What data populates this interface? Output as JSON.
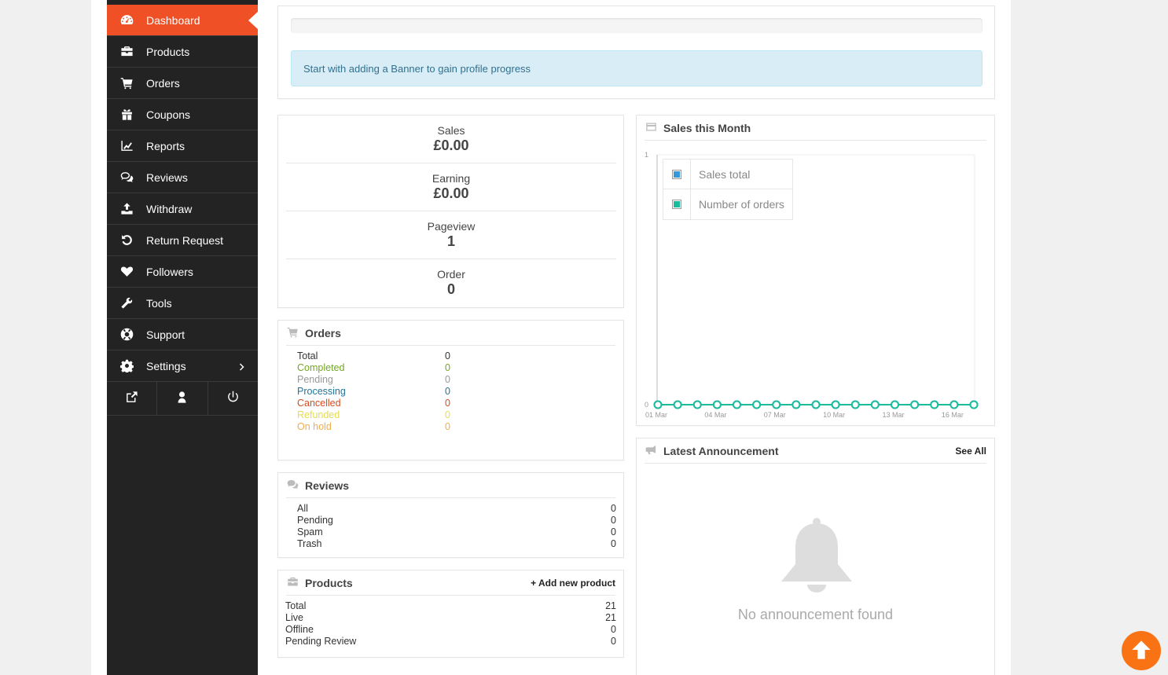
{
  "sidebar": {
    "items": [
      {
        "label": "Dashboard",
        "icon": "dashboard-icon"
      },
      {
        "label": "Products",
        "icon": "briefcase-icon"
      },
      {
        "label": "Orders",
        "icon": "cart-icon"
      },
      {
        "label": "Coupons",
        "icon": "gift-icon"
      },
      {
        "label": "Reports",
        "icon": "line-chart-icon"
      },
      {
        "label": "Reviews",
        "icon": "comments-icon"
      },
      {
        "label": "Withdraw",
        "icon": "upload-icon"
      },
      {
        "label": "Return Request",
        "icon": "undo-icon"
      },
      {
        "label": "Followers",
        "icon": "heart-icon"
      },
      {
        "label": "Tools",
        "icon": "wrench-icon"
      },
      {
        "label": "Support",
        "icon": "lifebuoy-icon"
      },
      {
        "label": "Settings",
        "icon": "gear-icon"
      }
    ],
    "actions": [
      "external-link-icon",
      "user-icon",
      "power-icon"
    ]
  },
  "progress": {
    "percent": 0,
    "message": "Start with adding a Banner to gain profile progress"
  },
  "stats": {
    "sales_label": "Sales",
    "sales_value": "£0.00",
    "earning_label": "Earning",
    "earning_value": "£0.00",
    "pageview_label": "Pageview",
    "pageview_value": "1",
    "order_label": "Order",
    "order_value": "0"
  },
  "orders": {
    "title": "Orders",
    "rows": [
      {
        "label": "Total",
        "value": "0",
        "color": "#333333"
      },
      {
        "label": "Completed",
        "value": "0",
        "color": "#73a724"
      },
      {
        "label": "Pending",
        "value": "0",
        "color": "#999999"
      },
      {
        "label": "Processing",
        "value": "0",
        "color": "#21759b"
      },
      {
        "label": "Cancelled",
        "value": "0",
        "color": "#d54e21"
      },
      {
        "label": "Refunded",
        "value": "0",
        "color": "#e6db55"
      },
      {
        "label": "On hold",
        "value": "0",
        "color": "#f0ad4e"
      }
    ]
  },
  "reviews": {
    "title": "Reviews",
    "rows": [
      {
        "label": "All",
        "value": "0"
      },
      {
        "label": "Pending",
        "value": "0"
      },
      {
        "label": "Spam",
        "value": "0"
      },
      {
        "label": "Trash",
        "value": "0"
      }
    ]
  },
  "products": {
    "title": "Products",
    "add_link": "+ Add new product",
    "rows": [
      {
        "label": "Total",
        "value": "21"
      },
      {
        "label": "Live",
        "value": "21"
      },
      {
        "label": "Offline",
        "value": "0"
      },
      {
        "label": "Pending Review",
        "value": "0"
      }
    ]
  },
  "sales_chart": {
    "title": "Sales this Month",
    "legend": [
      {
        "label": "Sales total",
        "color": "#3498db"
      },
      {
        "label": "Number of orders",
        "color": "#1abc9c"
      }
    ]
  },
  "chart_data": {
    "type": "line",
    "title": "Sales this Month",
    "x": [
      "01 Mar",
      "02 Mar",
      "03 Mar",
      "04 Mar",
      "05 Mar",
      "06 Mar",
      "07 Mar",
      "08 Mar",
      "09 Mar",
      "10 Mar",
      "11 Mar",
      "12 Mar",
      "13 Mar",
      "14 Mar",
      "15 Mar",
      "16 Mar",
      "17 Mar"
    ],
    "x_tick_labels": [
      "01 Mar",
      "04 Mar",
      "07 Mar",
      "10 Mar",
      "13 Mar",
      "16 Mar"
    ],
    "y_tick_labels": [
      "0",
      "1"
    ],
    "ylim": [
      0,
      1
    ],
    "series": [
      {
        "name": "Sales total",
        "color": "#3498db",
        "values": [
          0,
          0,
          0,
          0,
          0,
          0,
          0,
          0,
          0,
          0,
          0,
          0,
          0,
          0,
          0,
          0,
          0
        ]
      },
      {
        "name": "Number of orders",
        "color": "#1abc9c",
        "values": [
          0,
          0,
          0,
          0,
          0,
          0,
          0,
          0,
          0,
          0,
          0,
          0,
          0,
          0,
          0,
          0,
          0
        ]
      }
    ],
    "legend_position": "top-left",
    "grid": false
  },
  "announcement": {
    "title": "Latest Announcement",
    "see_all": "See All",
    "empty_text": "No announcement found"
  }
}
